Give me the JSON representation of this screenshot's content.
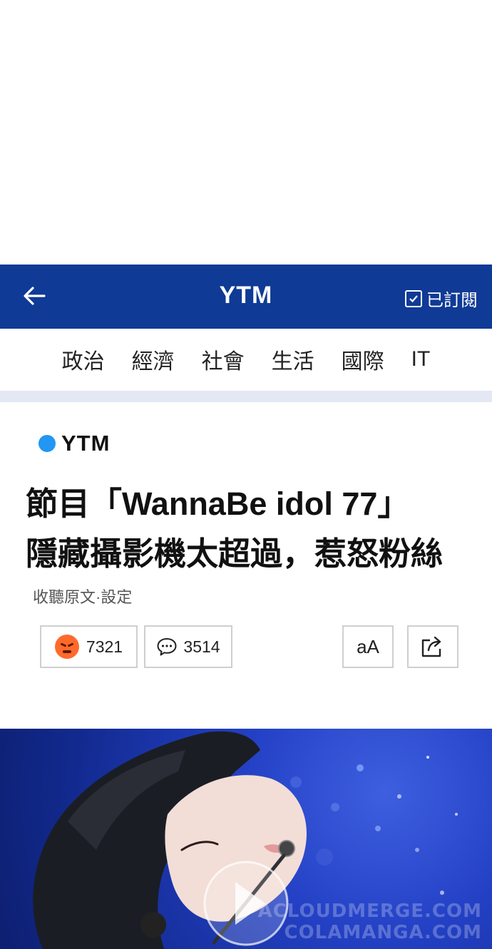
{
  "header": {
    "brand": "YTM",
    "subscribe_label": "已訂閱"
  },
  "nav": {
    "items": [
      "政治",
      "經濟",
      "社會",
      "生活",
      "國際",
      "IT"
    ]
  },
  "article": {
    "source": "YTM",
    "title_line1": "節目「WannaBe idol 77」",
    "title_line2": "隱藏攝影機太超過，惹怒粉絲",
    "listen_link": "收聽原文·設定",
    "angry_count": "7321",
    "comment_count": "3514",
    "font_button": "aA"
  },
  "watermark": {
    "line1": "ACLOUDMERGE.COM",
    "line2": "COLAMANGA.COM"
  },
  "colors": {
    "header_bg": "#0f3a96",
    "source_dot": "#2196f3",
    "angry": "#ff6a2b"
  }
}
